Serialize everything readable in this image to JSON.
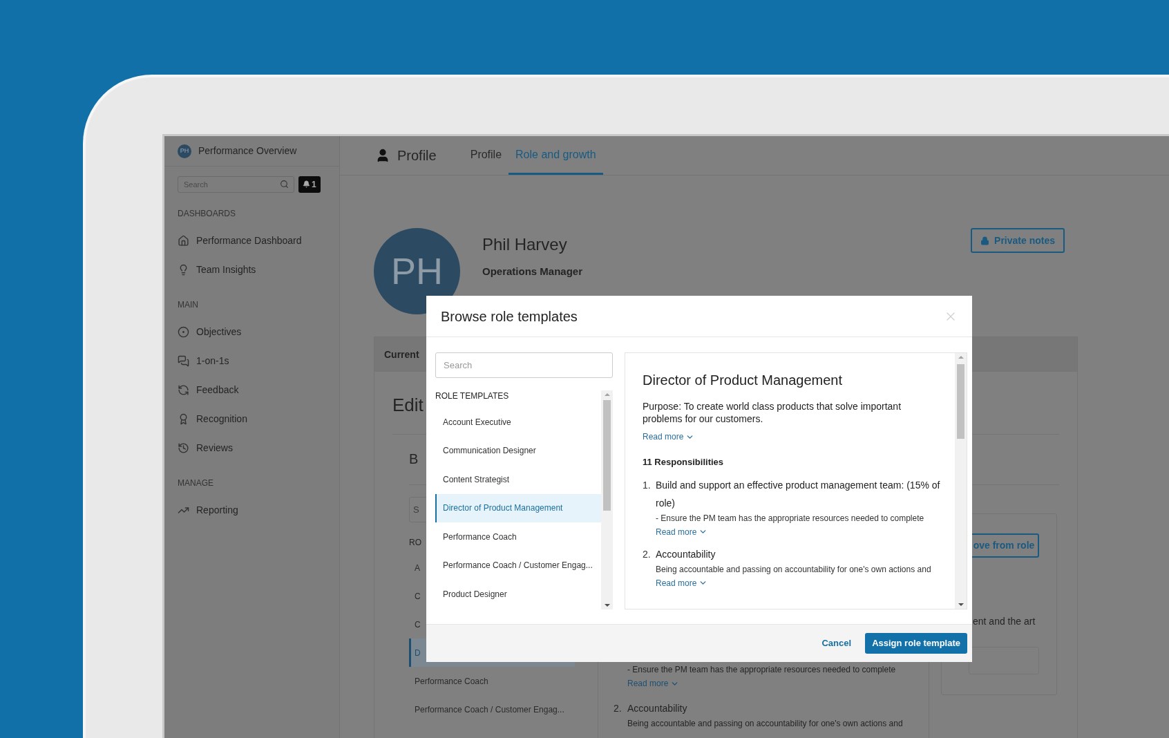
{
  "sidebar": {
    "avatar_initials": "PH",
    "app_title": "Performance Overview",
    "search": {
      "placeholder": "Search"
    },
    "notifications": {
      "count": "1"
    },
    "sections": [
      {
        "heading": "DASHBOARDS",
        "items": [
          {
            "label": "Performance Dashboard"
          },
          {
            "label": "Team Insights"
          }
        ]
      },
      {
        "heading": "MAIN",
        "items": [
          {
            "label": "Objectives"
          },
          {
            "label": "1-on-1s"
          },
          {
            "label": "Feedback"
          },
          {
            "label": "Recognition"
          },
          {
            "label": "Reviews"
          }
        ]
      },
      {
        "heading": "MANAGE",
        "items": [
          {
            "label": "Reporting"
          }
        ]
      }
    ]
  },
  "header": {
    "title": "Profile",
    "tabs": [
      {
        "label": "Profile",
        "selected": false
      },
      {
        "label": "Role and growth",
        "selected": true
      }
    ]
  },
  "profile": {
    "initials": "PH",
    "name": "Phil Harvey",
    "job_title": "Operations Manager",
    "private_notes_button": "Private notes"
  },
  "background_card": {
    "tab": "Current",
    "heading": "Edit",
    "subheading": "B",
    "search": {
      "placeholder": "S"
    },
    "list_heading": "RO",
    "list_items": [
      {
        "label": "A",
        "selected": false
      },
      {
        "label": "C",
        "selected": false
      },
      {
        "label": "C",
        "selected": false
      },
      {
        "label": "D",
        "selected": true
      },
      {
        "label": "Performance Coach",
        "selected": false
      },
      {
        "label": "Performance Coach / Customer Engag...",
        "selected": false
      }
    ],
    "responsibilities": [
      {
        "detail": "- Ensure the PM team has the appropriate resources needed to complete",
        "read_more": "Read more"
      },
      {
        "number": "2.",
        "title": "Accountability",
        "detail": "Being accountable and passing on accountability for one's own actions and"
      }
    ],
    "aside": {
      "button": "ove from role",
      "text": "ent and the art"
    }
  },
  "modal": {
    "title": "Browse role templates",
    "search": {
      "placeholder": "Search"
    },
    "list_heading": "ROLE TEMPLATES",
    "templates": [
      {
        "label": "Account Executive",
        "selected": false
      },
      {
        "label": "Communication Designer",
        "selected": false
      },
      {
        "label": "Content Strategist",
        "selected": false
      },
      {
        "label": "Director of Product Management",
        "selected": true
      },
      {
        "label": "Performance Coach",
        "selected": false
      },
      {
        "label": "Performance Coach / Customer Engag...",
        "selected": false
      },
      {
        "label": "Product Designer",
        "selected": false
      }
    ],
    "detail": {
      "title": "Director of Product Management",
      "purpose": "Purpose: To create world class products that solve important problems for our customers.",
      "read_more": "Read more",
      "responsibilities_heading": "11 Responsibilities",
      "responsibilities": [
        {
          "number": "1.",
          "title": "Build and support an effective product management team: (15% of role)",
          "detail": "- Ensure the PM team has the appropriate resources needed to complete",
          "read_more": "Read more"
        },
        {
          "number": "2.",
          "title": "Accountability",
          "detail": "Being accountable and passing on accountability for one's own actions and",
          "read_more": "Read more"
        }
      ]
    },
    "buttons": {
      "cancel": "Cancel",
      "assign": "Assign role template"
    }
  }
}
